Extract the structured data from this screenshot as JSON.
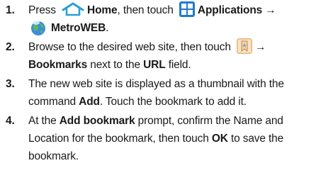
{
  "steps": [
    {
      "number": "1.",
      "line1_text": "Press",
      "home_label": "Home",
      "then_touch": ", then touch",
      "applications_label": "Applications →",
      "metroweb_label": "MetroWEB",
      "period": "."
    },
    {
      "number": "2.",
      "line1_text": "Browse to the desired web site, then touch",
      "arrow": "→",
      "bookmarks_label": "Bookmarks",
      "next_to_text": " next to the ",
      "url_label": "URL",
      "field_text": " field."
    },
    {
      "number": "3.",
      "line1_text": "The new web site is displayed as a thumbnail with the",
      "line2_pre": "command ",
      "add_label": "Add",
      "line2_post": ". Touch the bookmark to add it."
    },
    {
      "number": "4.",
      "at_text": "At the ",
      "add_bookmark_label": "Add bookmark",
      "line1_post": " prompt, confirm the Name and",
      "line2_text": "Location for the bookmark, then touch ",
      "ok_label": "OK",
      "line2_post": " to save the",
      "line3_text": "bookmark."
    }
  ],
  "icons": {
    "home": "home-icon",
    "applications": "applications-grid-icon",
    "metroweb": "metroweb-globe-icon",
    "bookmark": "bookmark-star-icon"
  },
  "colors": {
    "home_icon": "#2a9fd6",
    "apps_icon": "#1f7bd1",
    "bookmark_icon_bg": "#fbe4c6",
    "bookmark_icon_border": "#e5b47a"
  }
}
